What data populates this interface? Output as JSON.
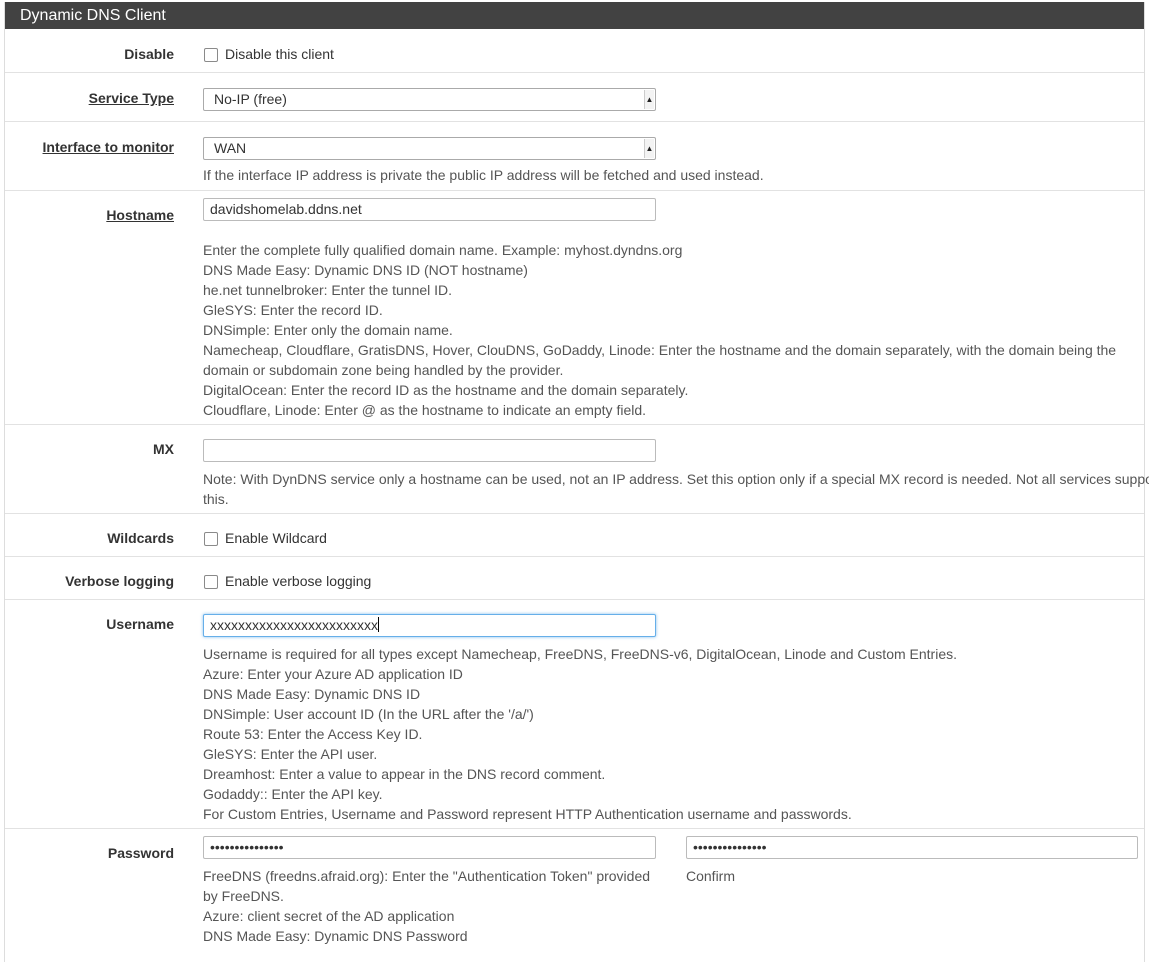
{
  "panel": {
    "title": "Dynamic DNS Client"
  },
  "disable": {
    "label": "Disable",
    "checkbox_label": "Disable this client"
  },
  "service_type": {
    "label": "Service Type",
    "value": "No-IP (free)"
  },
  "interface": {
    "label": "Interface to monitor",
    "value": "WAN",
    "help": "If the interface IP address is private the public IP address will be fetched and used instead."
  },
  "hostname": {
    "label": "Hostname",
    "value": "davidshomelab.ddns.net",
    "help": [
      "Enter the complete fully qualified domain name. Example: myhost.dyndns.org",
      "DNS Made Easy: Dynamic DNS ID (NOT hostname)",
      "he.net tunnelbroker: Enter the tunnel ID.",
      "GleSYS: Enter the record ID.",
      "DNSimple: Enter only the domain name.",
      "Namecheap, Cloudflare, GratisDNS, Hover, ClouDNS, GoDaddy, Linode: Enter the hostname and the domain separately, with the domain being the",
      "domain or subdomain zone being handled by the provider.",
      "DigitalOcean: Enter the record ID as the hostname and the domain separately.",
      "Cloudflare, Linode: Enter @ as the hostname to indicate an empty field."
    ]
  },
  "mx": {
    "label": "MX",
    "value": "",
    "help": [
      "Note: With DynDNS service only a hostname can be used, not an IP address. Set this option only if a special MX record is needed. Not all services support",
      "this."
    ]
  },
  "wildcards": {
    "label": "Wildcards",
    "checkbox_label": "Enable Wildcard"
  },
  "verbose": {
    "label": "Verbose logging",
    "checkbox_label": "Enable verbose logging"
  },
  "username": {
    "label": "Username",
    "value": "xxxxxxxxxxxxxxxxxxxxxxxx",
    "help": [
      "Username is required for all types except Namecheap, FreeDNS, FreeDNS-v6, DigitalOcean, Linode and Custom Entries.",
      "Azure: Enter your Azure AD application ID",
      "DNS Made Easy: Dynamic DNS ID",
      "DNSimple: User account ID (In the URL after the '/a/')",
      "Route 53: Enter the Access Key ID.",
      "GleSYS: Enter the API user.",
      "Dreamhost: Enter a value to appear in the DNS record comment.",
      "Godaddy:: Enter the API key.",
      "For Custom Entries, Username and Password represent HTTP Authentication username and passwords."
    ]
  },
  "password": {
    "label": "Password",
    "value": "•••••••••••••••",
    "confirm_value": "•••••••••••••••",
    "confirm_label": "Confirm",
    "help": [
      "FreeDNS (freedns.afraid.org): Enter the \"Authentication Token\" provided",
      "by FreeDNS.",
      "Azure: client secret of the AD application",
      "DNS Made Easy: Dynamic DNS Password"
    ]
  }
}
